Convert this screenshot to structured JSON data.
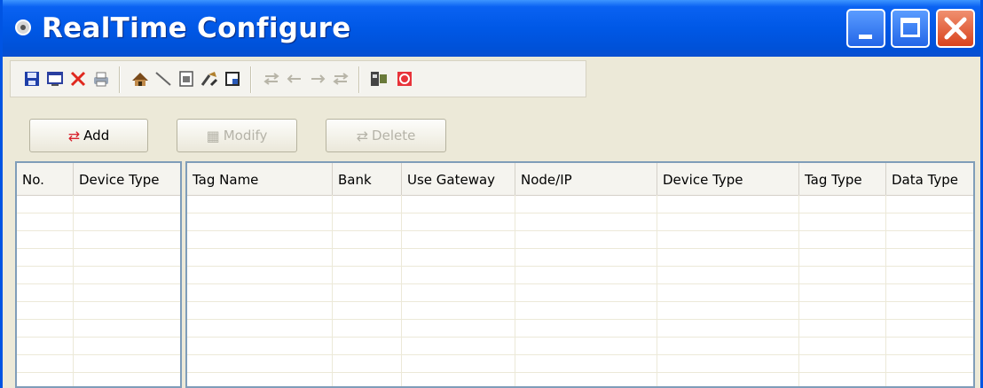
{
  "window": {
    "title": "RealTime Configure",
    "colors": {
      "title_bar": "#0058e6",
      "close_button": "#d8431d",
      "body": "#ece9d8"
    }
  },
  "title_buttons": [
    {
      "name": "minimize-button",
      "icon": "minimize-icon"
    },
    {
      "name": "maximize-button",
      "icon": "maximize-icon"
    },
    {
      "name": "close-button",
      "icon": "close-icon"
    }
  ],
  "toolbar": {
    "icons": [
      "save-icon",
      "window-icon",
      "delete-icon",
      "print-icon",
      "device-icon",
      "line-icon",
      "document-icon",
      "tools-icon",
      "export-icon",
      "move-both-icon",
      "move-left-icon",
      "move-right-icon",
      "move-both-icon-2",
      "group-icon",
      "stop-icon"
    ]
  },
  "actions": {
    "add_label": "Add",
    "modify_label": "Modify",
    "delete_label": "Delete"
  },
  "device_grid": {
    "columns": [
      "No.",
      "Device Type"
    ]
  },
  "tag_grid": {
    "columns": [
      "Tag Name",
      "Bank",
      "Use Gateway",
      "Node/IP",
      "Device Type",
      "Tag Type",
      "Data Type"
    ]
  }
}
